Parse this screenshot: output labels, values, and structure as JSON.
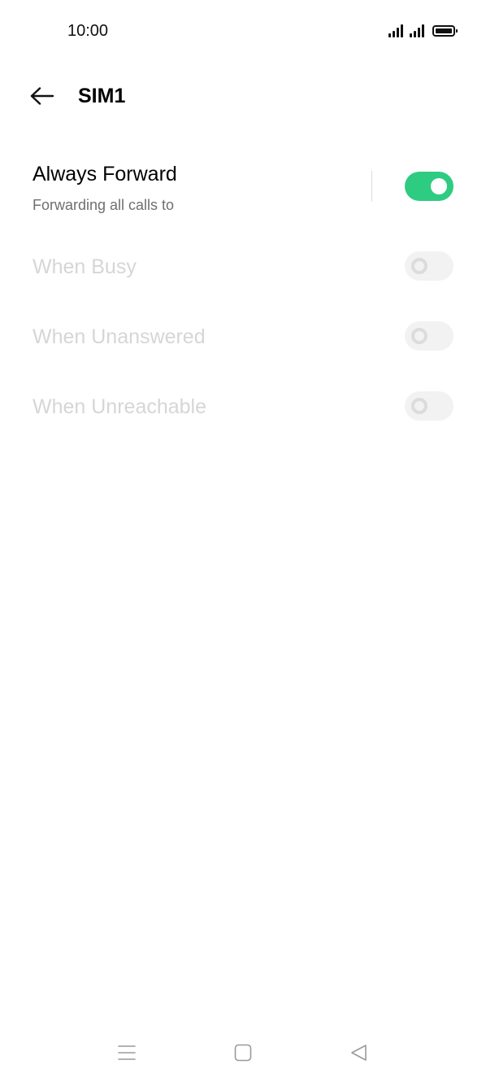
{
  "status_bar": {
    "time": "10:00",
    "icons": [
      "signal-icon",
      "signal-icon",
      "battery-icon"
    ]
  },
  "header": {
    "back_icon": "arrow-left-icon",
    "title": "SIM1"
  },
  "forwarding": {
    "always": {
      "title": "Always Forward",
      "subtitle": "Forwarding all calls to",
      "enabled": true
    },
    "busy": {
      "title": "When Busy",
      "enabled": false
    },
    "unanswered": {
      "title": "When Unanswered",
      "enabled": false
    },
    "unreachable": {
      "title": "When Unreachable",
      "enabled": false
    }
  },
  "nav_bar": {
    "icons": [
      "menu-icon",
      "home-icon",
      "back-triangle-icon"
    ]
  },
  "colors": {
    "accent": "#2ecc81",
    "disabled_text": "#d6d6d6",
    "secondary_text": "#6f6f6f"
  }
}
